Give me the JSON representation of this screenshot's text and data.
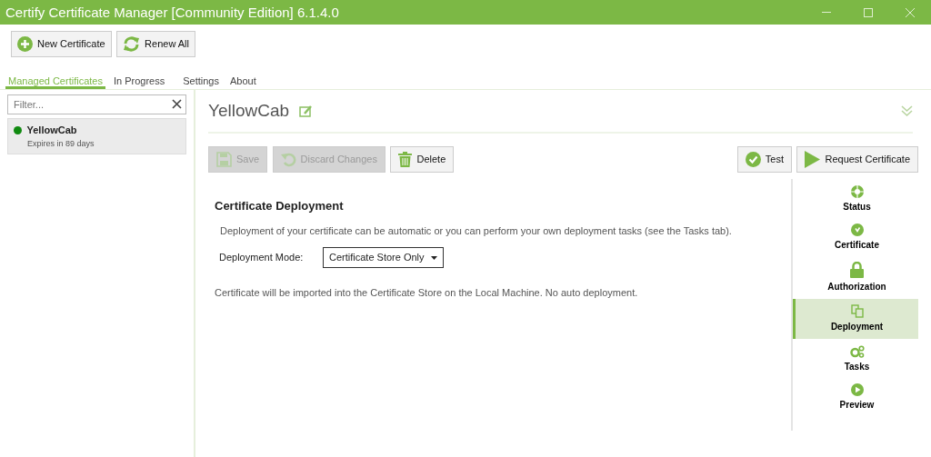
{
  "window": {
    "title": "Certify Certificate Manager [Community Edition] 6.1.4.0"
  },
  "toolbar": [
    {
      "kind": "new",
      "label": "New Certificate"
    },
    {
      "kind": "renew",
      "label": "Renew All"
    }
  ],
  "tabs": [
    {
      "label": "Managed Certificates",
      "selected": true
    },
    {
      "label": "In Progress",
      "selected": false
    },
    {
      "label": "Settings",
      "selected": false
    },
    {
      "label": "About",
      "selected": false
    }
  ],
  "filter": {
    "placeholder": "Filter..."
  },
  "certificates": [
    {
      "name": "YellowCab",
      "expiry": "Expires in 89 days",
      "color": "#108a10",
      "selected": true
    }
  ],
  "detail": {
    "title": "YellowCab",
    "actions_left": [
      {
        "kind": "save",
        "label": "Save",
        "disabled": true
      },
      {
        "kind": "discard",
        "label": "Discard Changes",
        "disabled": true
      },
      {
        "kind": "delete",
        "label": "Delete",
        "disabled": false
      }
    ],
    "actions_right": [
      {
        "kind": "test",
        "label": "Test",
        "disabled": false
      },
      {
        "kind": "request",
        "label": "Request Certificate",
        "disabled": false
      }
    ],
    "section": {
      "title": "Certificate Deployment",
      "description": "Deployment of your certificate can be automatic or you can perform your own deployment tasks (see the Tasks tab).",
      "mode_label": "Deployment Mode:",
      "mode_value": "Certificate Store Only",
      "note": "Certificate will be imported into the Certificate Store on the Local Machine. No auto deployment."
    },
    "nav": [
      {
        "kind": "status",
        "label": "Status",
        "selected": false
      },
      {
        "kind": "certificate",
        "label": "Certificate",
        "selected": false
      },
      {
        "kind": "authorization",
        "label": "Authorization",
        "selected": false
      },
      {
        "kind": "deployment",
        "label": "Deployment",
        "selected": true
      },
      {
        "kind": "tasks",
        "label": "Tasks",
        "selected": false
      },
      {
        "kind": "preview",
        "label": "Preview",
        "selected": false
      }
    ]
  }
}
